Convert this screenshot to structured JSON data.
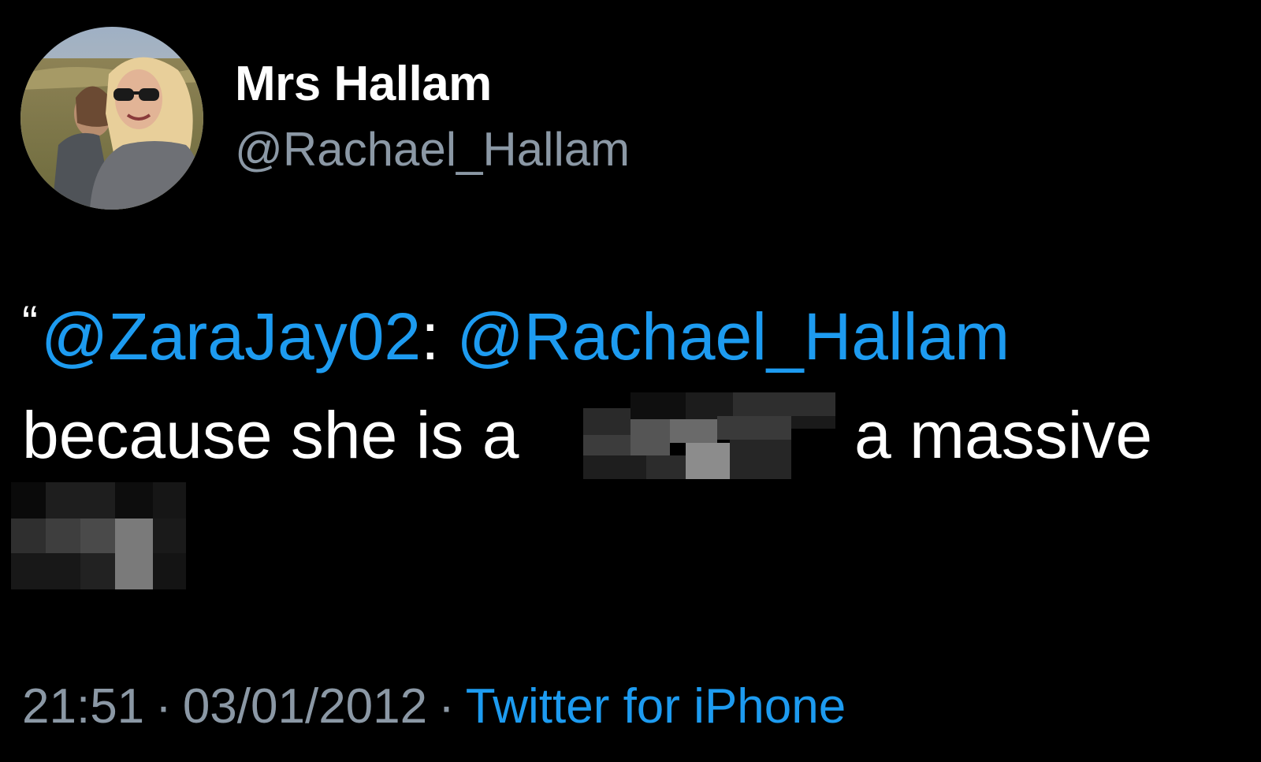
{
  "tweet": {
    "author": {
      "display_name": "Mrs Hallam",
      "handle": "@Rachael_Hallam"
    },
    "body": {
      "quote_open": "“",
      "mention_1": "@ZaraJay02",
      "colon": ":",
      "mention_2": "@Rachael_Hallam",
      "text_before_censor": "because she is a",
      "text_after_censor": "a massive"
    },
    "meta": {
      "time": "21:51",
      "separator": "·",
      "date": "03/01/2012",
      "source": "Twitter for iPhone"
    }
  },
  "colors": {
    "background": "#000000",
    "text": "#ffffff",
    "secondary": "#8b98a5",
    "link": "#1d9bf0"
  }
}
